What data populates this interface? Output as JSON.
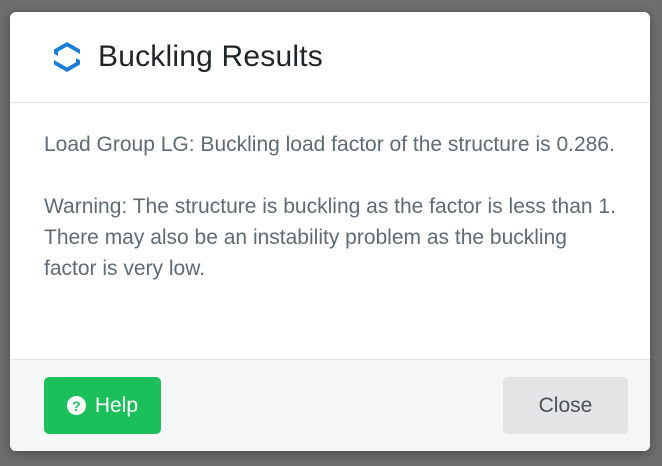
{
  "dialog": {
    "title": "Buckling Results",
    "logo_icon": "skyciv-logo-icon",
    "accent_color": "#1a7fd4"
  },
  "body": {
    "result_text": "Load Group LG: Buckling load factor of the structure is 0.286.",
    "warning_text": "Warning: The structure is buckling as the factor is less than 1. There may also be an instability problem as the buckling factor is very low."
  },
  "footer": {
    "help_label": "Help",
    "help_icon": "question-circle-icon",
    "help_color": "#1cc05a",
    "close_label": "Close"
  }
}
